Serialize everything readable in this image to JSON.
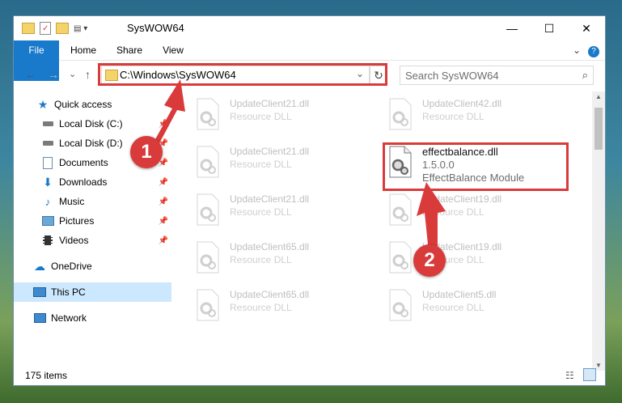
{
  "window": {
    "title": "SysWOW64",
    "minimize_label": "—",
    "maximize_label": "☐",
    "close_label": "✕"
  },
  "ribbon": {
    "tabs": [
      "File",
      "Home",
      "Share",
      "View"
    ],
    "expand_label": "⌄",
    "help_label": "?"
  },
  "nav": {
    "back": "←",
    "forward": "→",
    "recent": "⌄",
    "up": "↑",
    "address": "C:\\Windows\\SysWOW64",
    "address_dropdown": "⌄",
    "refresh": "↻",
    "search_placeholder": "Search SysWOW64",
    "search_icon": "⌕"
  },
  "sidebar": {
    "items": [
      {
        "label": "Quick access",
        "icon": "star-icon"
      },
      {
        "label": "Local Disk (C:)",
        "icon": "drive-icon"
      },
      {
        "label": "Local Disk (D:)",
        "icon": "drive-icon"
      },
      {
        "label": "Documents",
        "icon": "documents-icon"
      },
      {
        "label": "Downloads",
        "icon": "downloads-icon"
      },
      {
        "label": "Music",
        "icon": "music-icon"
      },
      {
        "label": "Pictures",
        "icon": "pictures-icon"
      },
      {
        "label": "Videos",
        "icon": "videos-icon"
      },
      {
        "label": "OneDrive",
        "icon": "cloud-icon"
      },
      {
        "label": "This PC",
        "icon": "computer-icon"
      },
      {
        "label": "Network",
        "icon": "network-icon"
      }
    ]
  },
  "files": [
    {
      "name": "UpdateClient21.dll",
      "sub": "Resource DLL"
    },
    {
      "name": "UpdateClient42.dll",
      "sub": "Resource DLL"
    },
    {
      "name": "UpdateClient21.dll",
      "sub": "Resource DLL"
    },
    {
      "name": "effectbalance.dll",
      "sub": "1.5.0.0",
      "sub2": "EffectBalance Module"
    },
    {
      "name": "UpdateClient21.dll",
      "sub": "Resource DLL"
    },
    {
      "name": "UpdateClient19.dll",
      "sub": "Resource DLL"
    },
    {
      "name": "UpdateClient65.dll",
      "sub": "Resource DLL"
    },
    {
      "name": "UpdateClient19.dll",
      "sub": "Resource DLL"
    },
    {
      "name": "UpdateClient65.dll",
      "sub": "Resource DLL"
    },
    {
      "name": "UpdateClient5.dll",
      "sub": "Resource DLL"
    }
  ],
  "status": {
    "count": "175 items"
  },
  "callouts": [
    "1",
    "2"
  ],
  "colors": {
    "accent": "#1979ca",
    "highlight": "#d93a3a",
    "selection": "#cce8ff"
  }
}
